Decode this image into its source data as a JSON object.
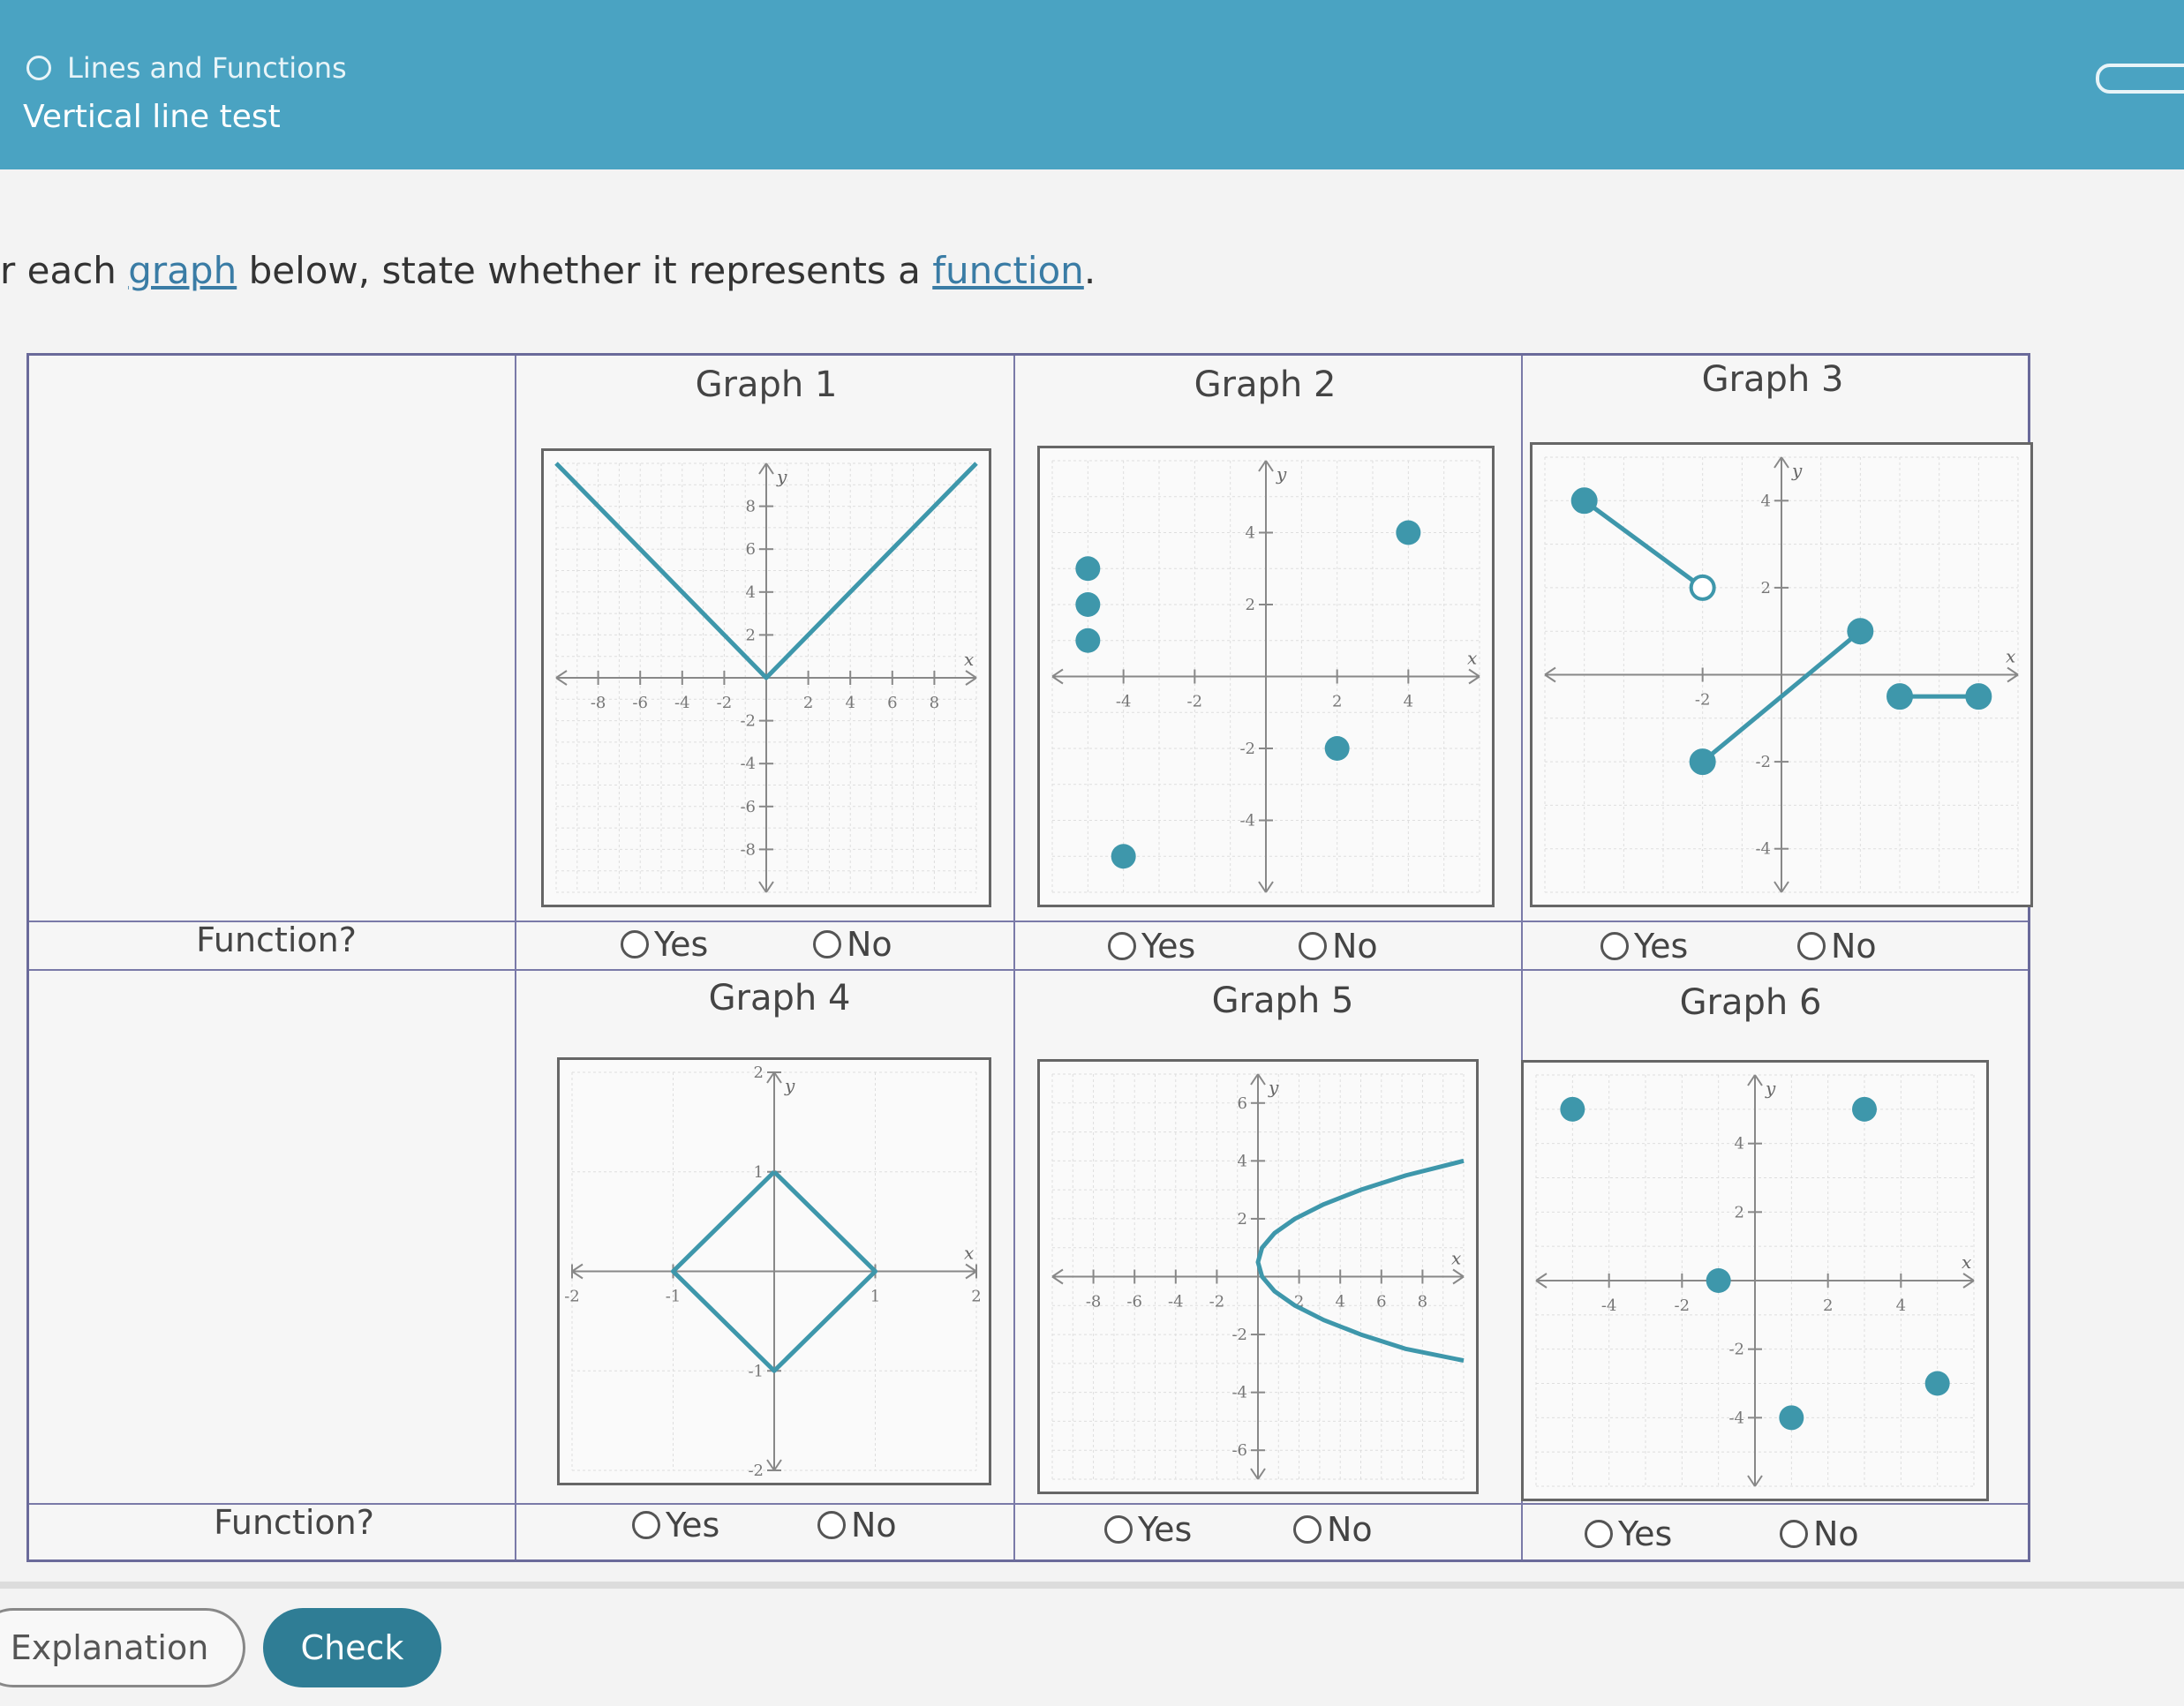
{
  "header": {
    "breadcrumb": "Lines and Functions",
    "title": "Vertical line test"
  },
  "instruction": {
    "prefix": "r each ",
    "link1": "graph",
    "middle": " below, state whether it represents a ",
    "link2": "function",
    "suffix": "."
  },
  "table": {
    "function_label": "Function?",
    "yes_label": "Yes",
    "no_label": "No",
    "graphs": [
      {
        "title": "Graph 1"
      },
      {
        "title": "Graph 2"
      },
      {
        "title": "Graph 3"
      },
      {
        "title": "Graph 4"
      },
      {
        "title": "Graph 5"
      },
      {
        "title": "Graph 6"
      }
    ]
  },
  "buttons": {
    "explanation": "Explanation",
    "check": "Check"
  },
  "colors": {
    "accent": "#4aa3c2",
    "graph_line": "#3e97ab",
    "check_button": "#2f7d95"
  },
  "chart_data": [
    {
      "type": "line",
      "title": "Graph 1",
      "xlabel": "x",
      "ylabel": "y",
      "xlim": [
        -10,
        10
      ],
      "ylim": [
        -10,
        10
      ],
      "x_ticks": [
        -8,
        -6,
        -4,
        -2,
        2,
        4,
        6,
        8
      ],
      "y_ticks": [
        -8,
        -6,
        -4,
        -2,
        2,
        4,
        6,
        8
      ],
      "series": [
        {
          "x": [
            -10,
            0,
            10
          ],
          "y": [
            10,
            0,
            10
          ]
        }
      ]
    },
    {
      "type": "scatter",
      "title": "Graph 2",
      "xlabel": "x",
      "ylabel": "y",
      "xlim": [
        -6,
        6
      ],
      "ylim": [
        -6,
        6
      ],
      "x_ticks": [
        -4,
        -2,
        2,
        4
      ],
      "y_ticks": [
        -4,
        -2,
        2,
        4
      ],
      "points": [
        [
          -5,
          3
        ],
        [
          -5,
          2
        ],
        [
          -5,
          1
        ],
        [
          -4,
          -5
        ],
        [
          4,
          4
        ],
        [
          2,
          -2
        ]
      ]
    },
    {
      "type": "line",
      "title": "Graph 3",
      "xlabel": "x",
      "ylabel": "y",
      "xlim": [
        -6,
        6
      ],
      "ylim": [
        -5,
        5
      ],
      "x_ticks": [
        -2
      ],
      "y_ticks": [
        -4,
        -2,
        2,
        4
      ],
      "segments": [
        {
          "from": [
            -5,
            4
          ],
          "to": [
            -2,
            2
          ],
          "from_closed": true,
          "to_closed": false
        },
        {
          "from": [
            -2,
            -2
          ],
          "to": [
            2,
            1
          ],
          "from_closed": true,
          "to_closed": true
        },
        {
          "from": [
            3,
            -0.5
          ],
          "to": [
            5,
            -0.5
          ],
          "from_closed": true,
          "to_closed": true
        }
      ]
    },
    {
      "type": "line",
      "title": "Graph 4",
      "xlabel": "x",
      "ylabel": "y",
      "xlim": [
        -2,
        2
      ],
      "ylim": [
        -2,
        2
      ],
      "x_ticks": [
        -2,
        -1,
        1,
        2
      ],
      "y_ticks": [
        -2,
        -1,
        1,
        2
      ],
      "series": [
        {
          "x": [
            0,
            1,
            0,
            -1,
            0
          ],
          "y": [
            1,
            0,
            -1,
            0,
            1
          ]
        }
      ]
    },
    {
      "type": "line",
      "title": "Graph 5",
      "xlabel": "x",
      "ylabel": "y",
      "xlim": [
        -10,
        10
      ],
      "ylim": [
        -7,
        7
      ],
      "x_ticks": [
        -8,
        -6,
        -4,
        -2,
        2,
        4,
        6,
        8
      ],
      "y_ticks": [
        -6,
        -4,
        -2,
        2,
        4,
        6
      ],
      "series": [
        {
          "x": [
            10,
            7.2,
            5,
            3.2,
            1.8,
            0.8,
            0.2,
            0,
            0.2,
            0.8,
            1.8,
            3.2,
            5,
            7.2,
            10
          ],
          "y": [
            4,
            3.5,
            3,
            2.5,
            2,
            1.5,
            1,
            0.5,
            0,
            -0.5,
            -1,
            -1.5,
            -2,
            -2.5,
            -2.9
          ]
        }
      ]
    },
    {
      "type": "scatter",
      "title": "Graph 6",
      "xlabel": "x",
      "ylabel": "y",
      "xlim": [
        -6,
        6
      ],
      "ylim": [
        -6,
        6
      ],
      "x_ticks": [
        -4,
        -2,
        2,
        4
      ],
      "y_ticks": [
        -4,
        -2,
        2,
        4
      ],
      "points": [
        [
          -5,
          5
        ],
        [
          3,
          5
        ],
        [
          -1,
          0
        ],
        [
          1,
          -4
        ],
        [
          5,
          -3
        ]
      ]
    }
  ]
}
